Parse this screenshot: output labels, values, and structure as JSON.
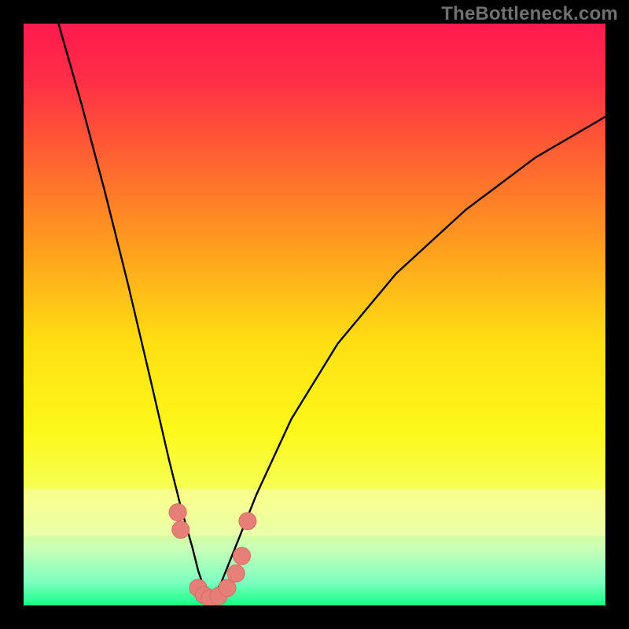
{
  "watermark": "TheBottleneck.com",
  "colors": {
    "frame": "#000000",
    "gradient_stops": [
      {
        "offset": 0.0,
        "color": "#ff1a4f"
      },
      {
        "offset": 0.1,
        "color": "#ff2f46"
      },
      {
        "offset": 0.25,
        "color": "#ff6a2e"
      },
      {
        "offset": 0.4,
        "color": "#ffa41c"
      },
      {
        "offset": 0.55,
        "color": "#ffe013"
      },
      {
        "offset": 0.7,
        "color": "#fdf81a"
      },
      {
        "offset": 0.8,
        "color": "#f6ff55"
      },
      {
        "offset": 0.9,
        "color": "#ccffb6"
      },
      {
        "offset": 0.96,
        "color": "#7cffc0"
      },
      {
        "offset": 1.0,
        "color": "#17ff87"
      }
    ],
    "whitish_band_top": "#fdffb0",
    "whitish_band_bottom": "#e6ffc6",
    "curve": "#000000",
    "marker_fill": "#e77f79",
    "marker_stroke": "#d76a64"
  },
  "chart_data": {
    "type": "line",
    "title": "",
    "xlabel": "",
    "ylabel": "",
    "xlim": [
      0,
      100
    ],
    "ylim": [
      0,
      100
    ],
    "notes": "V-shaped bottleneck curve. Left branch descends steeply from top-left; minimum around x≈32 at the bottom edge; right branch rises with decreasing slope toward the upper-right. Salmon markers cluster near the trough on both branches, coinciding with a pale band near the bottom.",
    "series": [
      {
        "name": "left-branch",
        "x": [
          6,
          10,
          14,
          18,
          22,
          25,
          27,
          29,
          30,
          31,
          32
        ],
        "y": [
          100,
          86,
          71,
          55,
          38,
          25,
          17,
          10,
          6,
          3,
          0.5
        ]
      },
      {
        "name": "right-branch",
        "x": [
          32,
          34,
          36,
          40,
          46,
          54,
          64,
          76,
          88,
          100
        ],
        "y": [
          0.5,
          4,
          9,
          19,
          32,
          45,
          57,
          68,
          77,
          84
        ]
      }
    ],
    "markers": [
      {
        "x": 26.5,
        "y": 16
      },
      {
        "x": 27.0,
        "y": 13
      },
      {
        "x": 30.0,
        "y": 3.0
      },
      {
        "x": 31.0,
        "y": 1.8
      },
      {
        "x": 32.0,
        "y": 1.2
      },
      {
        "x": 33.5,
        "y": 1.6
      },
      {
        "x": 35.0,
        "y": 3.0
      },
      {
        "x": 36.5,
        "y": 5.5
      },
      {
        "x": 37.5,
        "y": 8.5
      },
      {
        "x": 38.5,
        "y": 14.5
      }
    ],
    "whitish_band": {
      "y_from": 12,
      "y_to": 20
    }
  }
}
